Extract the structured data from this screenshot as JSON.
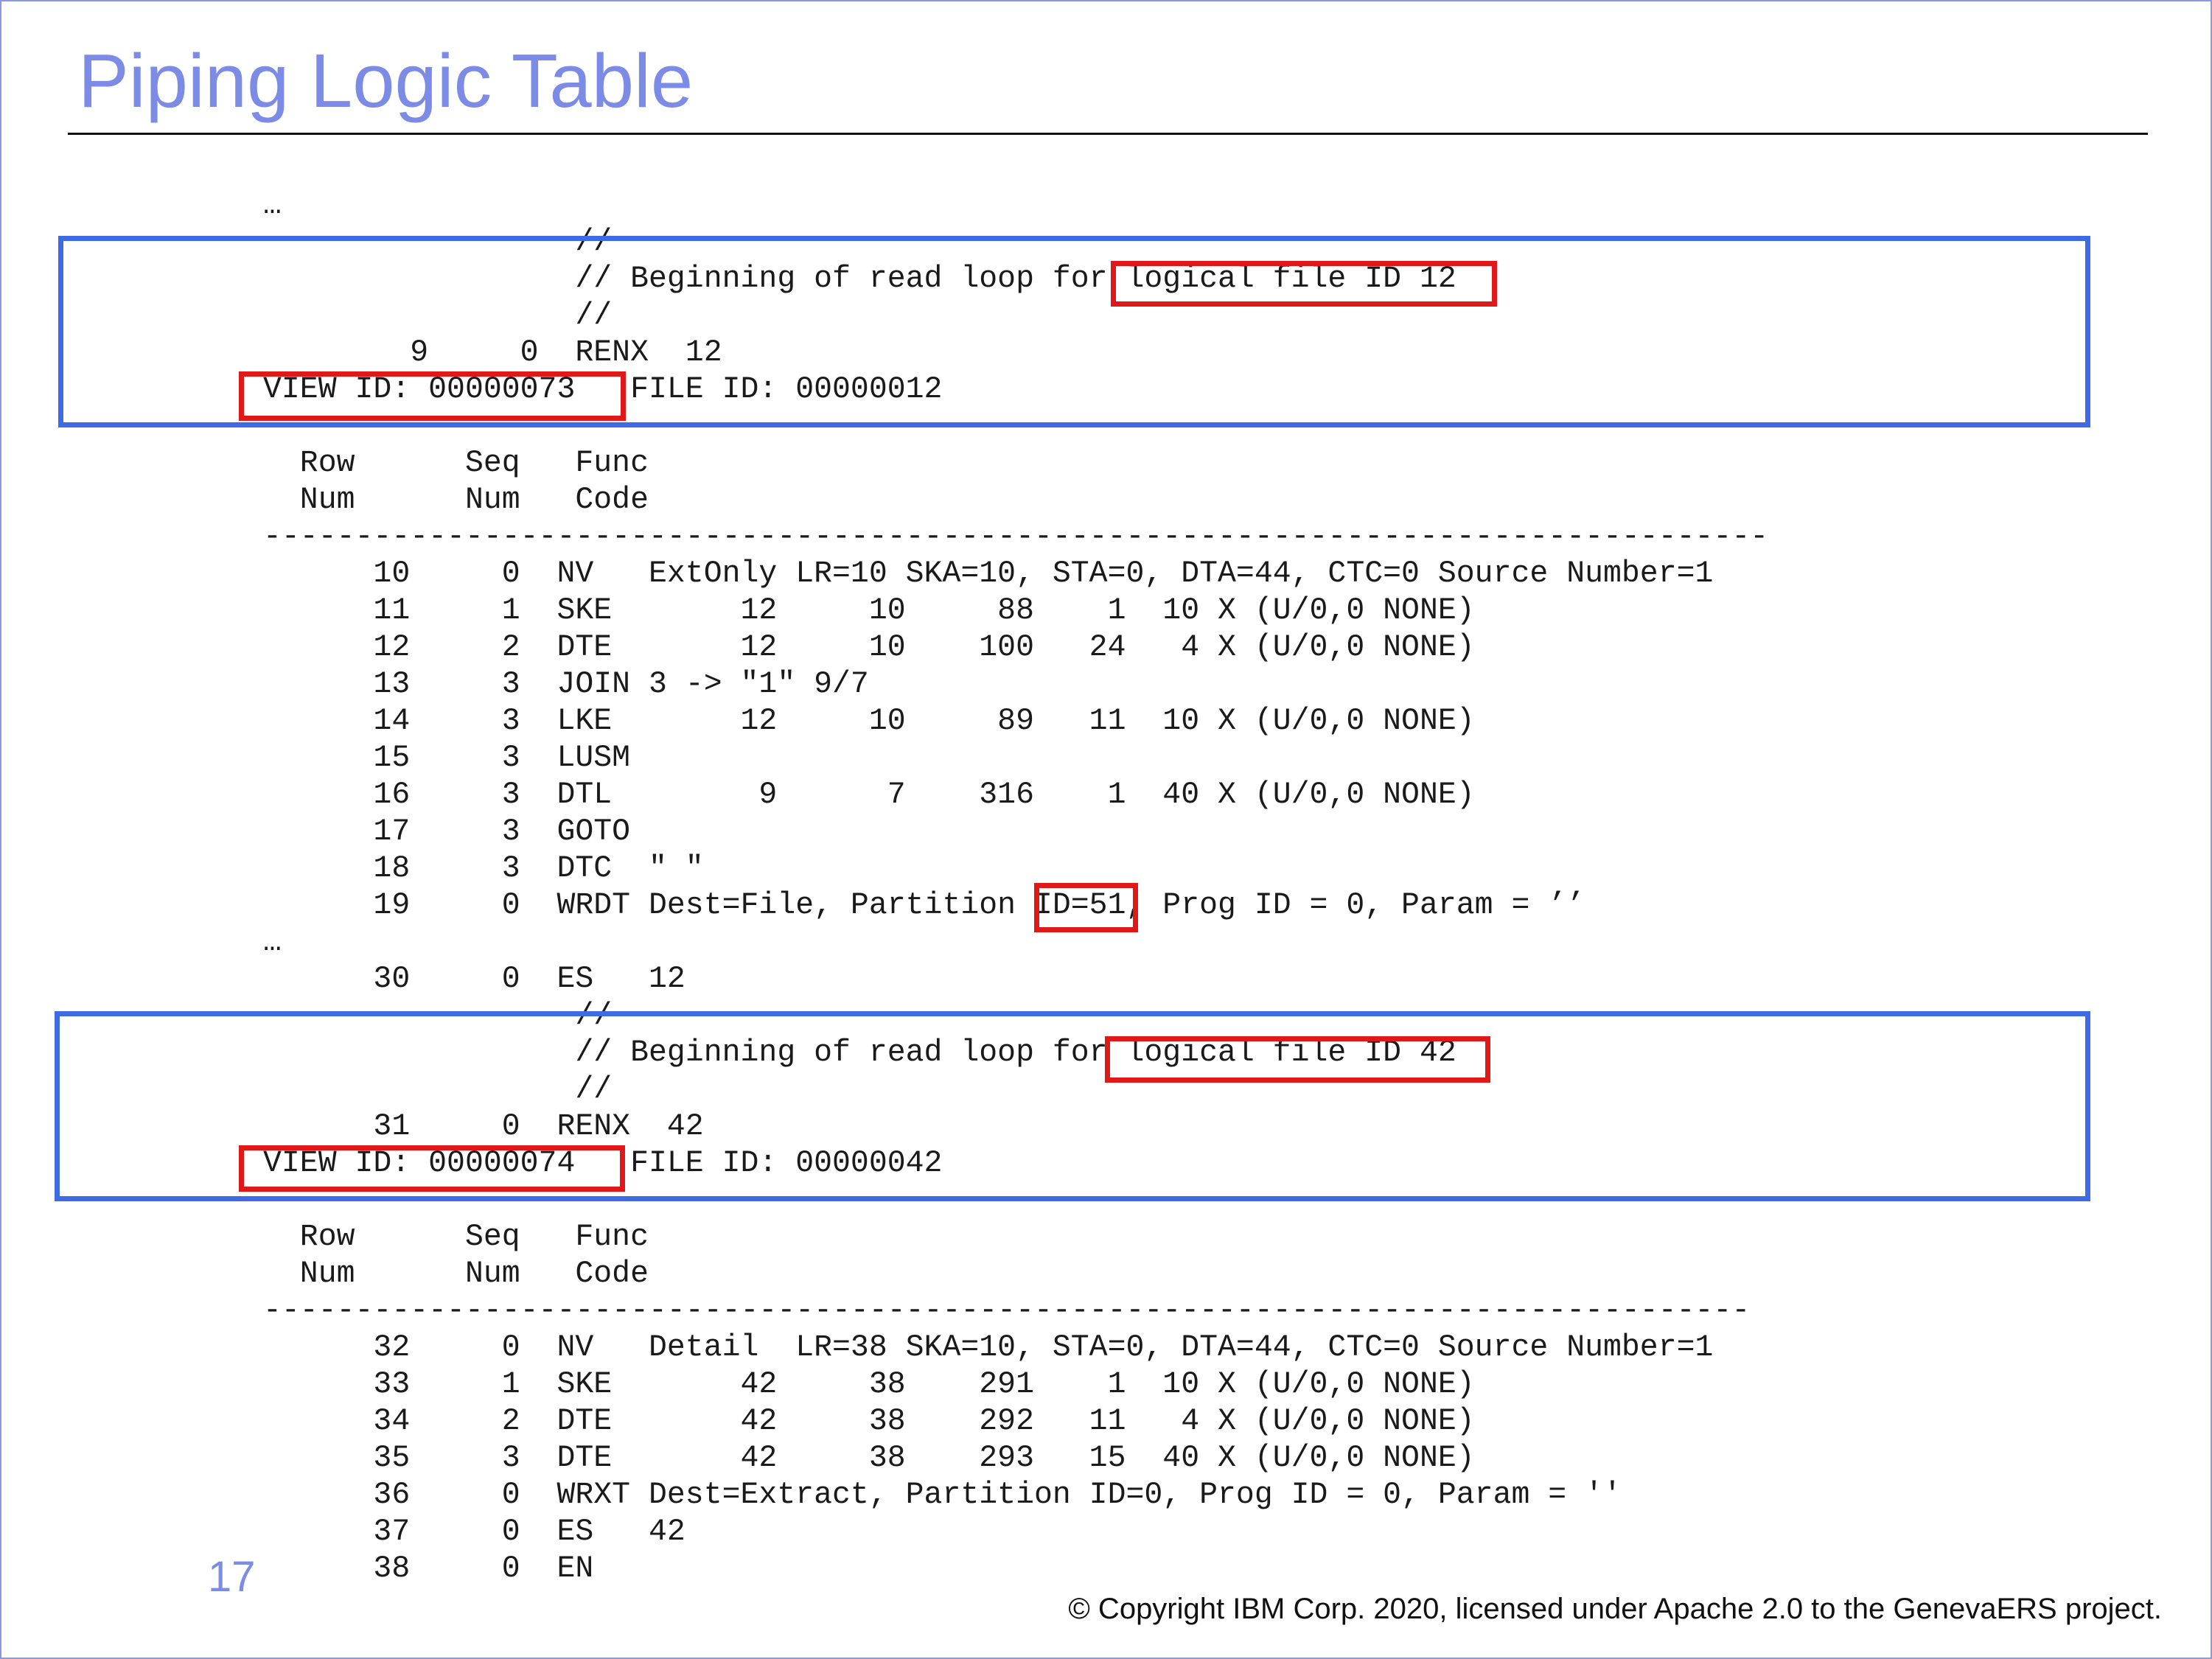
{
  "slide": {
    "title": "Piping Logic Table",
    "page_number": "17",
    "copyright": "© Copyright IBM Corp. 2020, licensed under Apache 2.0 to the GenevaERS project."
  },
  "listing": [
    "…",
    "                 //",
    "                 // Beginning of read loop for logical file ID 12",
    "                 //",
    "        9     0  RENX  12",
    "VIEW ID: 00000073   FILE ID: 00000012",
    "----------------------------------------------------------------------------------",
    "  Row      Seq   Func",
    "  Num      Num   Code",
    "----------------------------------------------------------------------------------",
    "      10     0  NV   ExtOnly LR=10 SKA=10, STA=0, DTA=44, CTC=0 Source Number=1",
    "      11     1  SKE       12     10     88    1  10 X (U/0,0 NONE)",
    "      12     2  DTE       12     10    100   24   4 X (U/0,0 NONE)",
    "      13     3  JOIN 3 -> \"1\" 9/7",
    "      14     3  LKE       12     10     89   11  10 X (U/0,0 NONE)",
    "      15     3  LUSM",
    "      16     3  DTL        9      7    316    1  40 X (U/0,0 NONE)",
    "      17     3  GOTO",
    "      18     3  DTC  \" \"",
    "      19     0  WRDT Dest=File, Partition ID=51, Prog ID = 0, Param = ’’",
    "…",
    "      30     0  ES   12",
    "                 //",
    "                 // Beginning of read loop for logical file ID 42",
    "                 //",
    "      31     0  RENX  42",
    "VIEW ID: 00000074   FILE ID: 00000042",
    "---------------------------------------------------------------------------------",
    "  Row      Seq   Func",
    "  Num      Num   Code",
    "---------------------------------------------------------------------------------",
    "      32     0  NV   Detail  LR=38 SKA=10, STA=0, DTA=44, CTC=0 Source Number=1",
    "      33     1  SKE       42     38    291    1  10 X (U/0,0 NONE)",
    "      34     2  DTE       42     38    292   11   4 X (U/0,0 NONE)",
    "      35     3  DTE       42     38    293   15  40 X (U/0,0 NONE)",
    "      36     0  WRXT Dest=Extract, Partition ID=0, Prog ID = 0, Param = ''",
    "      37     0  ES   42",
    "      38     0  EN"
  ],
  "highlights": {
    "blue_border_color": "#3f6ae6",
    "red_border_color": "#e01818"
  }
}
